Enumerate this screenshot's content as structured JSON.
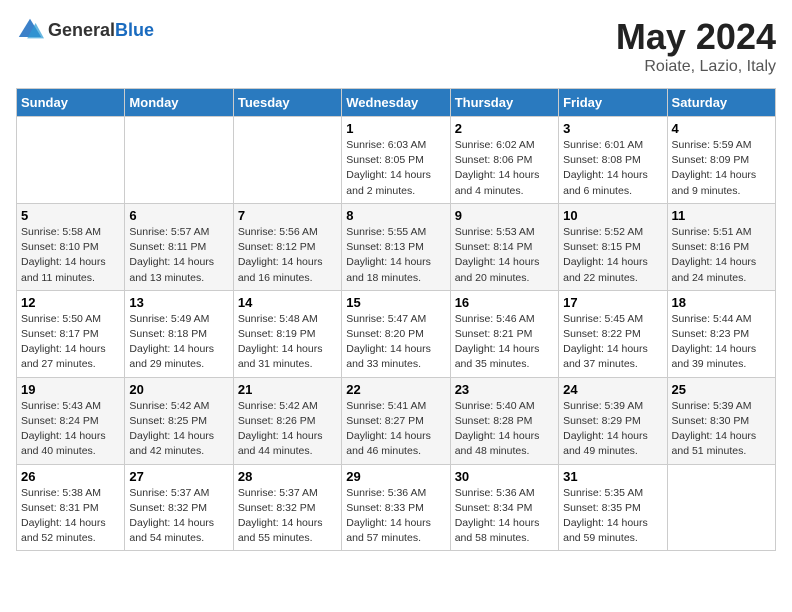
{
  "logo": {
    "general": "General",
    "blue": "Blue"
  },
  "title": "May 2024",
  "location": "Roiate, Lazio, Italy",
  "days_of_week": [
    "Sunday",
    "Monday",
    "Tuesday",
    "Wednesday",
    "Thursday",
    "Friday",
    "Saturday"
  ],
  "weeks": [
    [
      {
        "day": "",
        "info": ""
      },
      {
        "day": "",
        "info": ""
      },
      {
        "day": "",
        "info": ""
      },
      {
        "day": "1",
        "info": "Sunrise: 6:03 AM\nSunset: 8:05 PM\nDaylight: 14 hours and 2 minutes."
      },
      {
        "day": "2",
        "info": "Sunrise: 6:02 AM\nSunset: 8:06 PM\nDaylight: 14 hours and 4 minutes."
      },
      {
        "day": "3",
        "info": "Sunrise: 6:01 AM\nSunset: 8:08 PM\nDaylight: 14 hours and 6 minutes."
      },
      {
        "day": "4",
        "info": "Sunrise: 5:59 AM\nSunset: 8:09 PM\nDaylight: 14 hours and 9 minutes."
      }
    ],
    [
      {
        "day": "5",
        "info": "Sunrise: 5:58 AM\nSunset: 8:10 PM\nDaylight: 14 hours and 11 minutes."
      },
      {
        "day": "6",
        "info": "Sunrise: 5:57 AM\nSunset: 8:11 PM\nDaylight: 14 hours and 13 minutes."
      },
      {
        "day": "7",
        "info": "Sunrise: 5:56 AM\nSunset: 8:12 PM\nDaylight: 14 hours and 16 minutes."
      },
      {
        "day": "8",
        "info": "Sunrise: 5:55 AM\nSunset: 8:13 PM\nDaylight: 14 hours and 18 minutes."
      },
      {
        "day": "9",
        "info": "Sunrise: 5:53 AM\nSunset: 8:14 PM\nDaylight: 14 hours and 20 minutes."
      },
      {
        "day": "10",
        "info": "Sunrise: 5:52 AM\nSunset: 8:15 PM\nDaylight: 14 hours and 22 minutes."
      },
      {
        "day": "11",
        "info": "Sunrise: 5:51 AM\nSunset: 8:16 PM\nDaylight: 14 hours and 24 minutes."
      }
    ],
    [
      {
        "day": "12",
        "info": "Sunrise: 5:50 AM\nSunset: 8:17 PM\nDaylight: 14 hours and 27 minutes."
      },
      {
        "day": "13",
        "info": "Sunrise: 5:49 AM\nSunset: 8:18 PM\nDaylight: 14 hours and 29 minutes."
      },
      {
        "day": "14",
        "info": "Sunrise: 5:48 AM\nSunset: 8:19 PM\nDaylight: 14 hours and 31 minutes."
      },
      {
        "day": "15",
        "info": "Sunrise: 5:47 AM\nSunset: 8:20 PM\nDaylight: 14 hours and 33 minutes."
      },
      {
        "day": "16",
        "info": "Sunrise: 5:46 AM\nSunset: 8:21 PM\nDaylight: 14 hours and 35 minutes."
      },
      {
        "day": "17",
        "info": "Sunrise: 5:45 AM\nSunset: 8:22 PM\nDaylight: 14 hours and 37 minutes."
      },
      {
        "day": "18",
        "info": "Sunrise: 5:44 AM\nSunset: 8:23 PM\nDaylight: 14 hours and 39 minutes."
      }
    ],
    [
      {
        "day": "19",
        "info": "Sunrise: 5:43 AM\nSunset: 8:24 PM\nDaylight: 14 hours and 40 minutes."
      },
      {
        "day": "20",
        "info": "Sunrise: 5:42 AM\nSunset: 8:25 PM\nDaylight: 14 hours and 42 minutes."
      },
      {
        "day": "21",
        "info": "Sunrise: 5:42 AM\nSunset: 8:26 PM\nDaylight: 14 hours and 44 minutes."
      },
      {
        "day": "22",
        "info": "Sunrise: 5:41 AM\nSunset: 8:27 PM\nDaylight: 14 hours and 46 minutes."
      },
      {
        "day": "23",
        "info": "Sunrise: 5:40 AM\nSunset: 8:28 PM\nDaylight: 14 hours and 48 minutes."
      },
      {
        "day": "24",
        "info": "Sunrise: 5:39 AM\nSunset: 8:29 PM\nDaylight: 14 hours and 49 minutes."
      },
      {
        "day": "25",
        "info": "Sunrise: 5:39 AM\nSunset: 8:30 PM\nDaylight: 14 hours and 51 minutes."
      }
    ],
    [
      {
        "day": "26",
        "info": "Sunrise: 5:38 AM\nSunset: 8:31 PM\nDaylight: 14 hours and 52 minutes."
      },
      {
        "day": "27",
        "info": "Sunrise: 5:37 AM\nSunset: 8:32 PM\nDaylight: 14 hours and 54 minutes."
      },
      {
        "day": "28",
        "info": "Sunrise: 5:37 AM\nSunset: 8:32 PM\nDaylight: 14 hours and 55 minutes."
      },
      {
        "day": "29",
        "info": "Sunrise: 5:36 AM\nSunset: 8:33 PM\nDaylight: 14 hours and 57 minutes."
      },
      {
        "day": "30",
        "info": "Sunrise: 5:36 AM\nSunset: 8:34 PM\nDaylight: 14 hours and 58 minutes."
      },
      {
        "day": "31",
        "info": "Sunrise: 5:35 AM\nSunset: 8:35 PM\nDaylight: 14 hours and 59 minutes."
      },
      {
        "day": "",
        "info": ""
      }
    ]
  ]
}
